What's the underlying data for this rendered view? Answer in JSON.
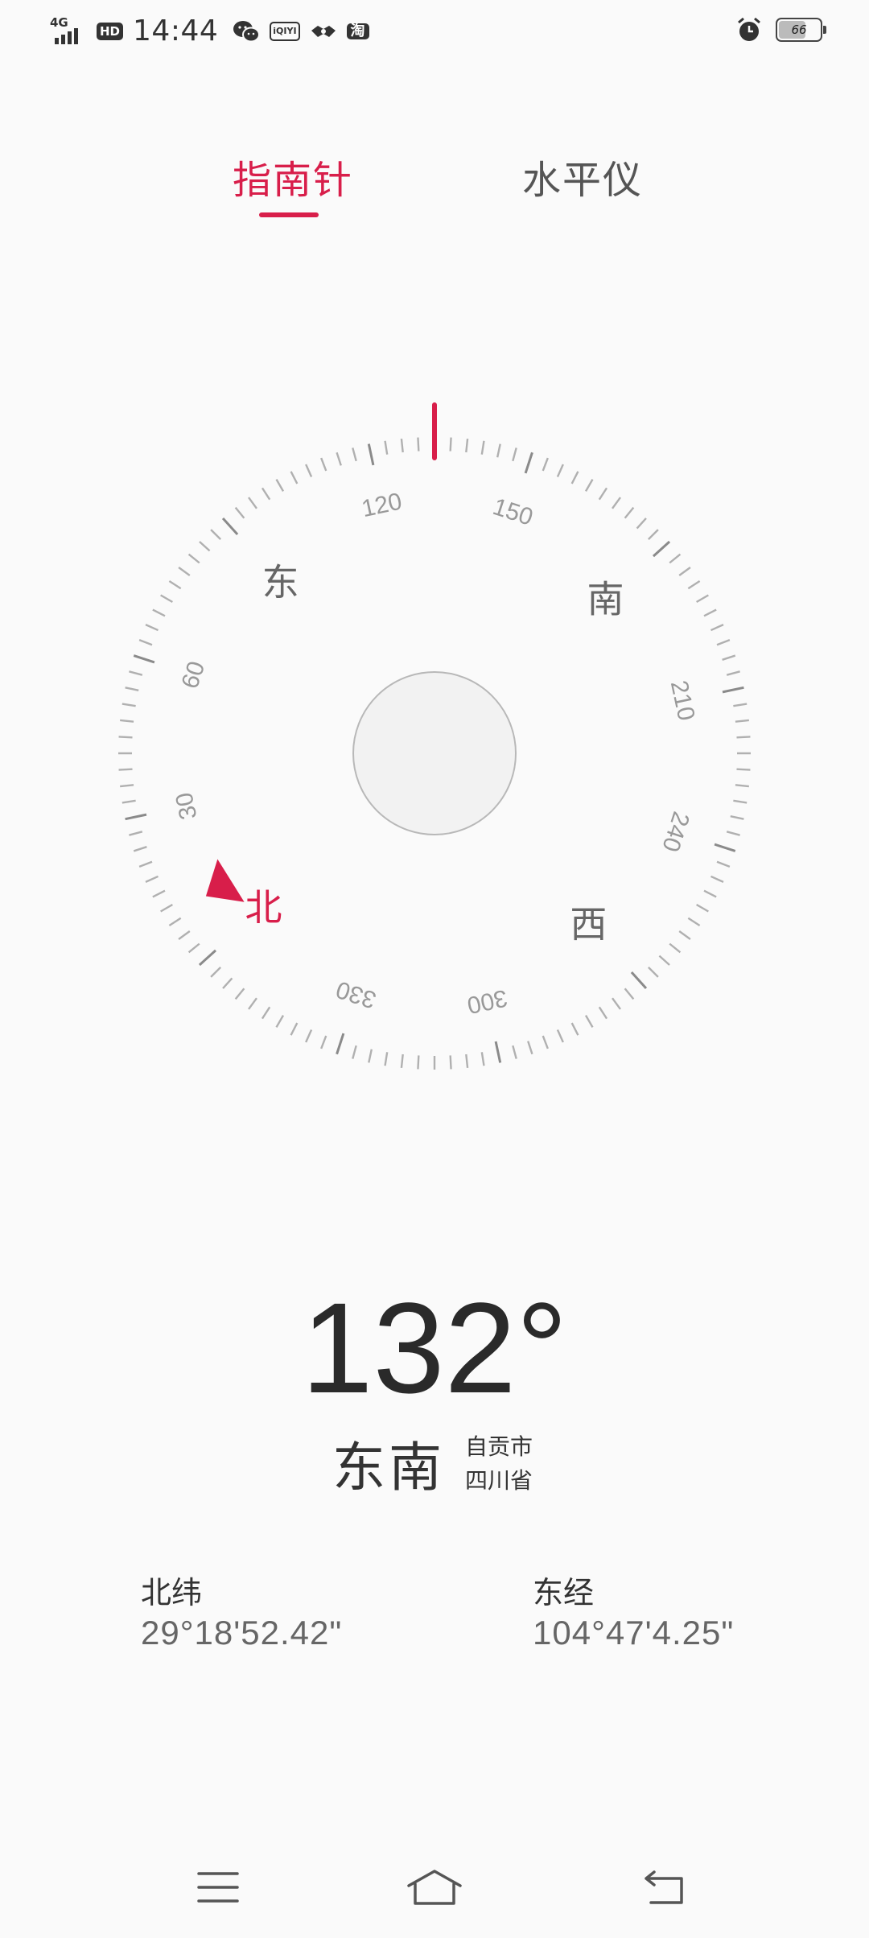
{
  "status_bar": {
    "network": "4G",
    "hd": "HD",
    "time": "14:44",
    "iqiyi": "iQIYI",
    "taobao": "淘",
    "battery": "66",
    "battery_level_pct": 66
  },
  "tabs": [
    {
      "label": "指南针",
      "active": true
    },
    {
      "label": "水平仪",
      "active": false
    }
  ],
  "compass": {
    "heading_deg": 132,
    "tick_labels": [
      "30",
      "60",
      "120",
      "150",
      "210",
      "240",
      "300",
      "330"
    ],
    "cardinals": {
      "north": "北",
      "east": "东",
      "south": "南",
      "west": "西"
    },
    "accent_color": "#d81e4a"
  },
  "readout": {
    "heading": "132°",
    "direction": "东南",
    "city": "自贡市",
    "province": "四川省"
  },
  "coordinates": {
    "lat_label": "北纬",
    "lat_value": "29°18'52.42\"",
    "lon_label": "东经",
    "lon_value": "104°47'4.25\""
  }
}
